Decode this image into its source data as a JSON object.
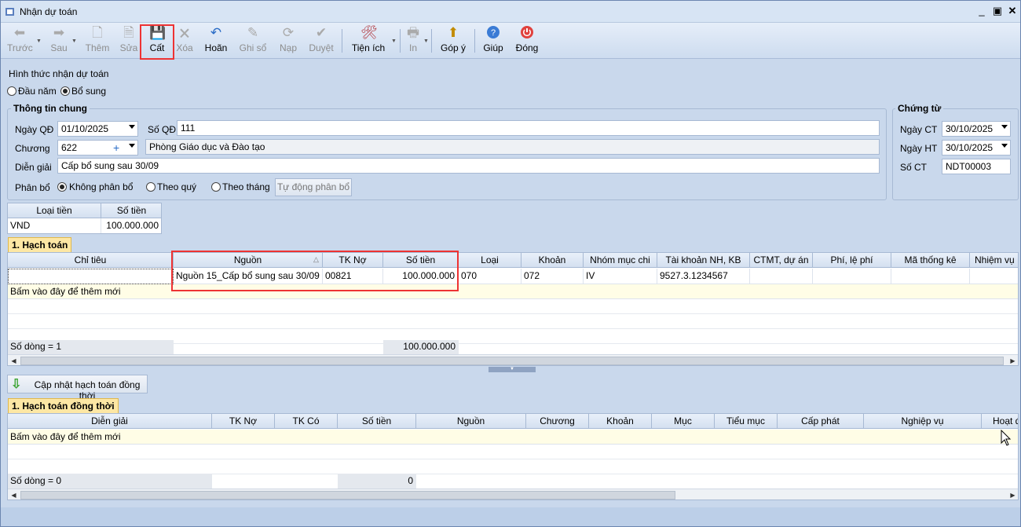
{
  "window": {
    "title": "Nhận dự toán"
  },
  "toolbar": {
    "prev": "Trước",
    "next": "Sau",
    "add": "Thêm",
    "edit": "Sửa",
    "save": "Cất",
    "delete": "Xóa",
    "undo": "Hoãn",
    "post": "Ghi sổ",
    "reload": "Nạp",
    "approve": "Duyệt",
    "utilities": "Tiện ích",
    "print": "In",
    "feedback": "Góp ý",
    "help": "Giúp",
    "close": "Đóng"
  },
  "form": {
    "mode_label": "Hình thức nhận dự toán",
    "mode_options": [
      "Đầu năm",
      "Bổ sung"
    ],
    "mode_selected": "Bổ sung",
    "general_title": "Thông tin chung",
    "ngay_qd_label": "Ngày QĐ",
    "ngay_qd": "01/10/2025",
    "so_qd_label": "Số QĐ",
    "so_qd": "111",
    "chuong_label": "Chương",
    "chuong": "622",
    "chuong_name": "Phòng Giáo dục và Đào tạo",
    "dien_giai_label": "Diễn giải",
    "dien_giai": "Cấp bổ sung sau 30/09",
    "phan_bo_label": "Phân bổ",
    "phan_bo_options": [
      "Không phân bổ",
      "Theo quý",
      "Theo tháng"
    ],
    "phan_bo_selected": "Không phân bổ",
    "auto_alloc_button": "Tự động phân bổ"
  },
  "voucher": {
    "title": "Chứng từ",
    "ngay_ct_label": "Ngày CT",
    "ngay_ct": "30/10/2025",
    "ngay_ht_label": "Ngày HT",
    "ngay_ht": "30/10/2025",
    "so_ct_label": "Số CT",
    "so_ct": "NDT00003"
  },
  "currency": {
    "headers": [
      "Loại tiền",
      "Số tiền"
    ],
    "row": [
      "VND",
      "100.000.000"
    ]
  },
  "accounting": {
    "tab": "1. Hạch toán",
    "headers": [
      "Chỉ tiêu",
      "Nguồn",
      "TK Nợ",
      "Số tiền",
      "Loại",
      "Khoản",
      "Nhóm mục chi",
      "Tài khoản NH, KB",
      "CTMT, dự án",
      "Phí, lệ phí",
      "Mã thống kê",
      "Nhiệm vụ"
    ],
    "row": [
      "",
      "Nguồn 15_Cấp bổ sung sau 30/09",
      "00821",
      "100.000.000",
      "070",
      "072",
      "IV",
      "9527.3.1234567",
      "",
      "",
      "",
      ""
    ],
    "new_row_text": "Bấm vào đây để thêm mới",
    "footer_count": "Số dòng = 1",
    "footer_total": "100.000.000"
  },
  "update_button": "Cập nhật hạch toán đồng thời",
  "concurrent": {
    "tab": "1. Hạch toán đồng thời",
    "headers": [
      "Diễn giải",
      "TK Nợ",
      "TK Có",
      "Số tiền",
      "Nguồn",
      "Chương",
      "Khoản",
      "Mục",
      "Tiểu mục",
      "Cấp phát",
      "Nghiệp vụ",
      "Hoạt đ"
    ],
    "new_row_text": "Bấm vào đây để thêm mới",
    "footer_count": "Số dòng = 0",
    "footer_total": "0"
  },
  "colors": {
    "highlight": "#e33333",
    "tab": "#fde7a4",
    "new_row": "#fffde6"
  }
}
